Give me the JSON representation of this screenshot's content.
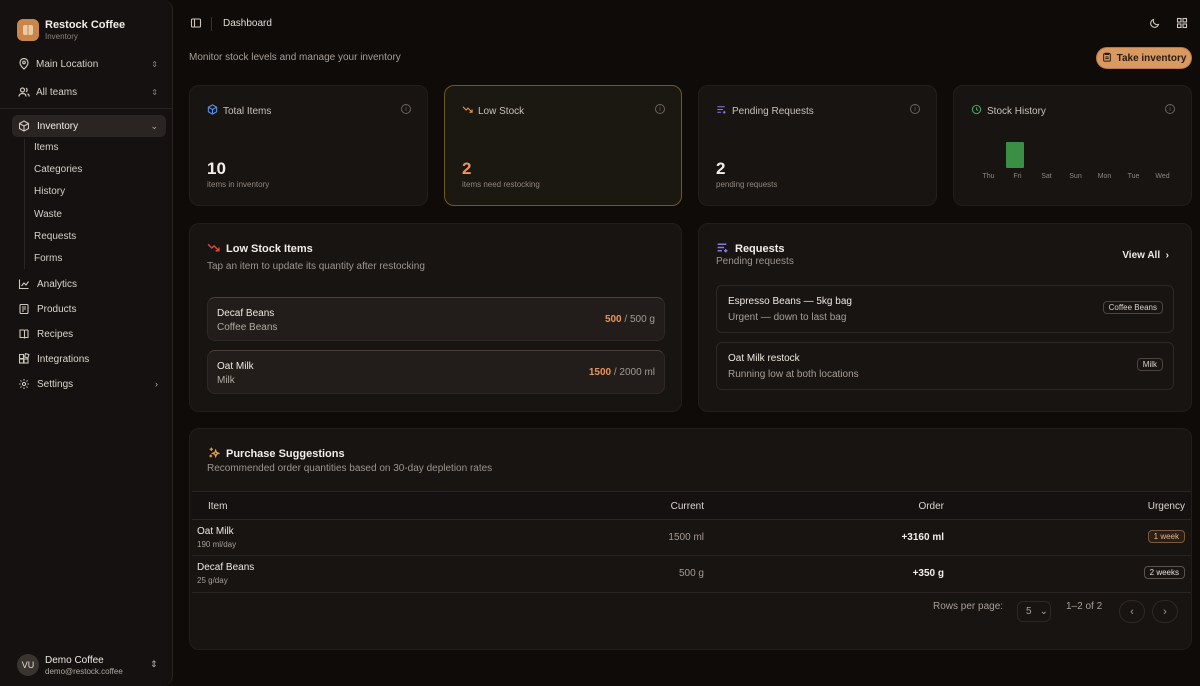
{
  "sidebar": {
    "brand": {
      "name": "Restock Coffee",
      "sub": "Inventory"
    },
    "location": "Main Location",
    "teams": "All teams",
    "nav": {
      "inventory": "Inventory",
      "sub": [
        "Items",
        "Categories",
        "History",
        "Waste",
        "Requests",
        "Forms"
      ],
      "analytics": "Analytics",
      "products": "Products",
      "recipes": "Recipes",
      "integrations": "Integrations",
      "settings": "Settings"
    },
    "user": {
      "initials": "VU",
      "name": "Demo Coffee",
      "email": "demo@restock.coffee"
    }
  },
  "header": {
    "title": "Dashboard"
  },
  "main": {
    "subtitle": "Monitor stock levels and manage your inventory",
    "take_inventory": "Take inventory",
    "stats": {
      "total": {
        "title": "Total Items",
        "value": "10",
        "label": "items in inventory"
      },
      "low": {
        "title": "Low Stock",
        "value": "2",
        "label": "items need restocking"
      },
      "pending": {
        "title": "Pending Requests",
        "value": "2",
        "label": "pending requests"
      },
      "history": {
        "title": "Stock History",
        "days": [
          "Thu",
          "Fri",
          "Sat",
          "Sun",
          "Mon",
          "Tue",
          "Wed"
        ]
      }
    },
    "low_stock": {
      "title": "Low Stock Items",
      "subtitle": "Tap an item to update its quantity after restocking",
      "items": [
        {
          "name": "Decaf Beans",
          "category": "Coffee Beans",
          "current": "500",
          "total": "/ 500 g"
        },
        {
          "name": "Oat Milk",
          "category": "Milk",
          "current": "1500",
          "total": "/ 2000 ml"
        }
      ]
    },
    "requests": {
      "title": "Requests",
      "subtitle": "Pending requests",
      "view_all": "View All",
      "items": [
        {
          "name": "Espresso Beans — 5kg bag",
          "desc": "Urgent — down to last bag",
          "badge": "Coffee Beans"
        },
        {
          "name": "Oat Milk restock",
          "desc": "Running low at both locations",
          "badge": "Milk"
        }
      ]
    },
    "suggestions": {
      "title": "Purchase Suggestions",
      "subtitle": "Recommended order quantities based on 30-day depletion rates",
      "columns": [
        "Item",
        "Current",
        "Order",
        "Urgency"
      ],
      "rows": [
        {
          "item": "Oat Milk",
          "rate": "190 ml/day",
          "current": "1500 ml",
          "order": "+3160 ml",
          "urgency": "1 week"
        },
        {
          "item": "Decaf Beans",
          "rate": "25 g/day",
          "current": "500 g",
          "order": "+350 g",
          "urgency": "2 weeks"
        }
      ],
      "rows_per_page_label": "Rows per page:",
      "rows_per_page": "5",
      "range": "1–2 of 2"
    }
  }
}
